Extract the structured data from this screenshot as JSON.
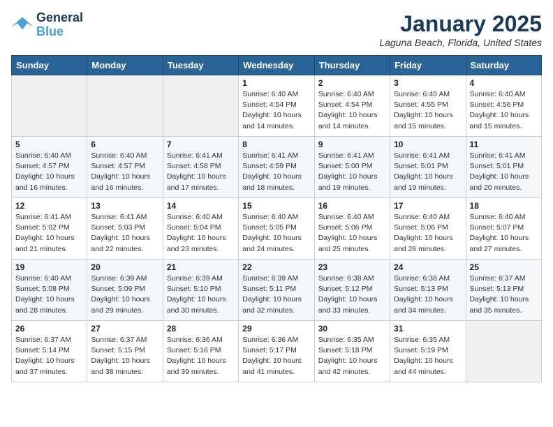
{
  "logo": {
    "line1": "General",
    "line2": "Blue"
  },
  "title": "January 2025",
  "location": "Laguna Beach, Florida, United States",
  "weekdays": [
    "Sunday",
    "Monday",
    "Tuesday",
    "Wednesday",
    "Thursday",
    "Friday",
    "Saturday"
  ],
  "weeks": [
    [
      {
        "day": "",
        "info": ""
      },
      {
        "day": "",
        "info": ""
      },
      {
        "day": "",
        "info": ""
      },
      {
        "day": "1",
        "info": "Sunrise: 6:40 AM\nSunset: 4:54 PM\nDaylight: 10 hours\nand 14 minutes."
      },
      {
        "day": "2",
        "info": "Sunrise: 6:40 AM\nSunset: 4:54 PM\nDaylight: 10 hours\nand 14 minutes."
      },
      {
        "day": "3",
        "info": "Sunrise: 6:40 AM\nSunset: 4:55 PM\nDaylight: 10 hours\nand 15 minutes."
      },
      {
        "day": "4",
        "info": "Sunrise: 6:40 AM\nSunset: 4:56 PM\nDaylight: 10 hours\nand 15 minutes."
      }
    ],
    [
      {
        "day": "5",
        "info": "Sunrise: 6:40 AM\nSunset: 4:57 PM\nDaylight: 10 hours\nand 16 minutes."
      },
      {
        "day": "6",
        "info": "Sunrise: 6:40 AM\nSunset: 4:57 PM\nDaylight: 10 hours\nand 16 minutes."
      },
      {
        "day": "7",
        "info": "Sunrise: 6:41 AM\nSunset: 4:58 PM\nDaylight: 10 hours\nand 17 minutes."
      },
      {
        "day": "8",
        "info": "Sunrise: 6:41 AM\nSunset: 4:59 PM\nDaylight: 10 hours\nand 18 minutes."
      },
      {
        "day": "9",
        "info": "Sunrise: 6:41 AM\nSunset: 5:00 PM\nDaylight: 10 hours\nand 19 minutes."
      },
      {
        "day": "10",
        "info": "Sunrise: 6:41 AM\nSunset: 5:01 PM\nDaylight: 10 hours\nand 19 minutes."
      },
      {
        "day": "11",
        "info": "Sunrise: 6:41 AM\nSunset: 5:01 PM\nDaylight: 10 hours\nand 20 minutes."
      }
    ],
    [
      {
        "day": "12",
        "info": "Sunrise: 6:41 AM\nSunset: 5:02 PM\nDaylight: 10 hours\nand 21 minutes."
      },
      {
        "day": "13",
        "info": "Sunrise: 6:41 AM\nSunset: 5:03 PM\nDaylight: 10 hours\nand 22 minutes."
      },
      {
        "day": "14",
        "info": "Sunrise: 6:40 AM\nSunset: 5:04 PM\nDaylight: 10 hours\nand 23 minutes."
      },
      {
        "day": "15",
        "info": "Sunrise: 6:40 AM\nSunset: 5:05 PM\nDaylight: 10 hours\nand 24 minutes."
      },
      {
        "day": "16",
        "info": "Sunrise: 6:40 AM\nSunset: 5:06 PM\nDaylight: 10 hours\nand 25 minutes."
      },
      {
        "day": "17",
        "info": "Sunrise: 6:40 AM\nSunset: 5:06 PM\nDaylight: 10 hours\nand 26 minutes."
      },
      {
        "day": "18",
        "info": "Sunrise: 6:40 AM\nSunset: 5:07 PM\nDaylight: 10 hours\nand 27 minutes."
      }
    ],
    [
      {
        "day": "19",
        "info": "Sunrise: 6:40 AM\nSunset: 5:08 PM\nDaylight: 10 hours\nand 28 minutes."
      },
      {
        "day": "20",
        "info": "Sunrise: 6:39 AM\nSunset: 5:09 PM\nDaylight: 10 hours\nand 29 minutes."
      },
      {
        "day": "21",
        "info": "Sunrise: 6:39 AM\nSunset: 5:10 PM\nDaylight: 10 hours\nand 30 minutes."
      },
      {
        "day": "22",
        "info": "Sunrise: 6:39 AM\nSunset: 5:11 PM\nDaylight: 10 hours\nand 32 minutes."
      },
      {
        "day": "23",
        "info": "Sunrise: 6:38 AM\nSunset: 5:12 PM\nDaylight: 10 hours\nand 33 minutes."
      },
      {
        "day": "24",
        "info": "Sunrise: 6:38 AM\nSunset: 5:13 PM\nDaylight: 10 hours\nand 34 minutes."
      },
      {
        "day": "25",
        "info": "Sunrise: 6:37 AM\nSunset: 5:13 PM\nDaylight: 10 hours\nand 35 minutes."
      }
    ],
    [
      {
        "day": "26",
        "info": "Sunrise: 6:37 AM\nSunset: 5:14 PM\nDaylight: 10 hours\nand 37 minutes."
      },
      {
        "day": "27",
        "info": "Sunrise: 6:37 AM\nSunset: 5:15 PM\nDaylight: 10 hours\nand 38 minutes."
      },
      {
        "day": "28",
        "info": "Sunrise: 6:36 AM\nSunset: 5:16 PM\nDaylight: 10 hours\nand 39 minutes."
      },
      {
        "day": "29",
        "info": "Sunrise: 6:36 AM\nSunset: 5:17 PM\nDaylight: 10 hours\nand 41 minutes."
      },
      {
        "day": "30",
        "info": "Sunrise: 6:35 AM\nSunset: 5:18 PM\nDaylight: 10 hours\nand 42 minutes."
      },
      {
        "day": "31",
        "info": "Sunrise: 6:35 AM\nSunset: 5:19 PM\nDaylight: 10 hours\nand 44 minutes."
      },
      {
        "day": "",
        "info": ""
      }
    ]
  ]
}
